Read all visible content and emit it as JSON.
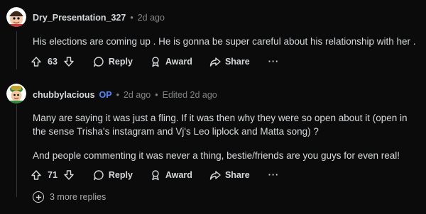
{
  "comments": [
    {
      "username": "Dry_Presentation_327",
      "op_badge": "",
      "time": "2d ago",
      "edited": "",
      "paragraphs": [
        "His elections are coming up . He is gonna be super careful about his relationship with her ."
      ],
      "score": "63",
      "reply_label": "Reply",
      "award_label": "Award",
      "share_label": "Share",
      "more_label": "···"
    },
    {
      "username": "chubbylacious",
      "op_badge": "OP",
      "time": "2d ago",
      "edited": "Edited 2d ago",
      "paragraphs": [
        "Many are saying it was just a fling. If it was then why they were so open about it (open in the sense Trisha's instagram and Vj's Leo liplock and Matta song) ?",
        "And people commenting it was never a thing, bestie/friends are you guys for even real!"
      ],
      "score": "71",
      "reply_label": "Reply",
      "award_label": "Award",
      "share_label": "Share",
      "more_label": "···",
      "more_replies": "3 more replies"
    }
  ]
}
